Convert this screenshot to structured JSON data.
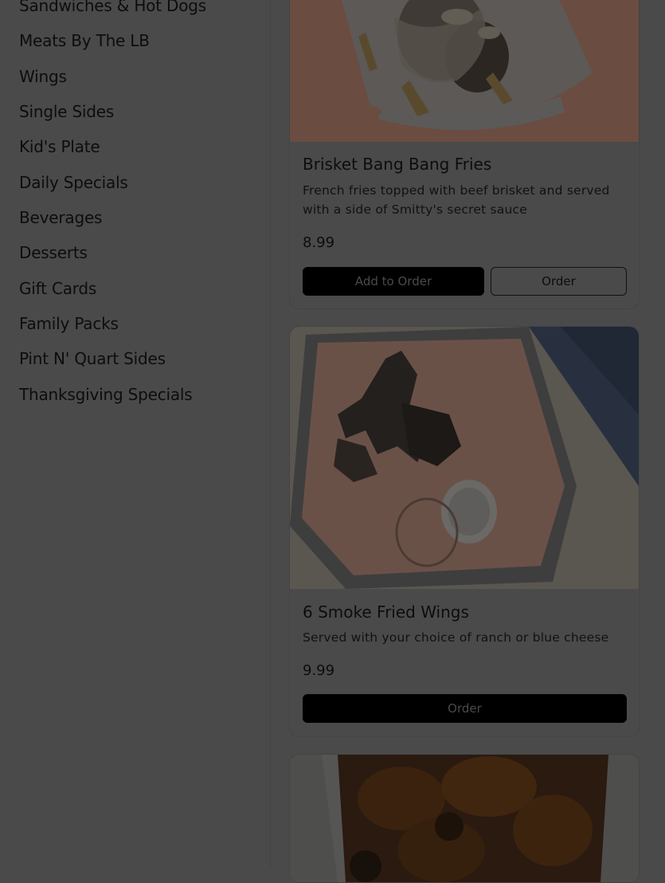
{
  "sidebar": {
    "items": [
      {
        "label": "Sandwiches & Hot Dogs"
      },
      {
        "label": "Meats By The LB"
      },
      {
        "label": "Wings"
      },
      {
        "label": "Single Sides"
      },
      {
        "label": "Kid's Plate"
      },
      {
        "label": "Daily Specials"
      },
      {
        "label": "Beverages"
      },
      {
        "label": "Desserts"
      },
      {
        "label": "Gift Cards"
      },
      {
        "label": "Family Packs"
      },
      {
        "label": "Pint N' Quart Sides"
      },
      {
        "label": "Thanksgiving Specials"
      }
    ]
  },
  "menu_items": [
    {
      "name": "Brisket Bang Bang Fries",
      "description": "French fries topped with beef brisket and served with a side of Smitty's secret sauce",
      "price": "8.99",
      "add_label": "Add to Order",
      "order_label": "Order"
    },
    {
      "name": "6 Smoke Fried Wings",
      "description": "Served with your choice of ranch or blue cheese",
      "price": "9.99",
      "order_label": "Order"
    }
  ],
  "colors": {
    "overlay_background": "#4a4a4a",
    "button_dark": "#000000",
    "text": "#0d0d0d"
  }
}
